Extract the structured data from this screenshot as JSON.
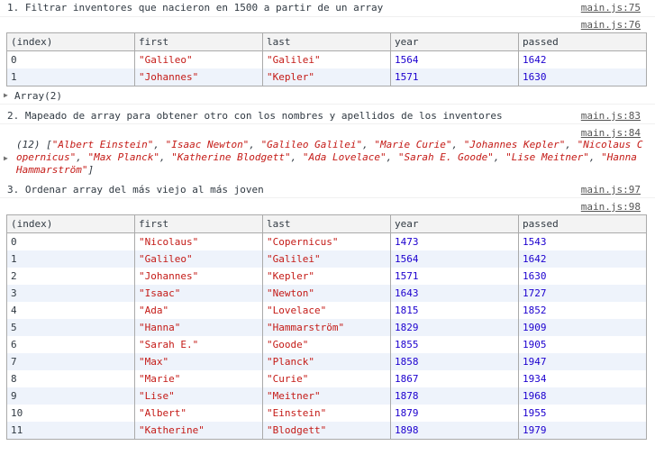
{
  "messages": [
    {
      "text": "1. Filtrar inventores que nacieron en 1500 a partir de un array",
      "source": "main.js:75"
    },
    {
      "text": "2. Mapeado de array para obtener otro con los nombres y apellidos de los inventores",
      "source": "main.js:83"
    },
    {
      "text": "3. Ordenar array del más viejo al más joven",
      "source": "main.js:97"
    }
  ],
  "table1": {
    "source": "main.js:76",
    "headers": [
      "(index)",
      "first",
      "last",
      "year",
      "passed"
    ],
    "rows": [
      [
        "0",
        "\"Galileo\"",
        "\"Galilei\"",
        "1564",
        "1642"
      ],
      [
        "1",
        "\"Johannes\"",
        "\"Kepler\"",
        "1571",
        "1630"
      ]
    ],
    "array_label": "Array(2)"
  },
  "map_log": {
    "source": "main.js:84",
    "count": "(12)",
    "items": [
      "Albert Einstein",
      "Isaac Newton",
      "Galileo Galilei",
      "Marie Curie",
      "Johannes Kepler",
      "Nicolaus Copernicus",
      "Max Planck",
      "Katherine Blodgett",
      "Ada Lovelace",
      "Sarah E. Goode",
      "Lise Meitner",
      "Hanna Hammarström"
    ]
  },
  "table2": {
    "source": "main.js:98",
    "headers": [
      "(index)",
      "first",
      "last",
      "year",
      "passed"
    ],
    "rows": [
      [
        "0",
        "\"Nicolaus\"",
        "\"Copernicus\"",
        "1473",
        "1543"
      ],
      [
        "1",
        "\"Galileo\"",
        "\"Galilei\"",
        "1564",
        "1642"
      ],
      [
        "2",
        "\"Johannes\"",
        "\"Kepler\"",
        "1571",
        "1630"
      ],
      [
        "3",
        "\"Isaac\"",
        "\"Newton\"",
        "1643",
        "1727"
      ],
      [
        "4",
        "\"Ada\"",
        "\"Lovelace\"",
        "1815",
        "1852"
      ],
      [
        "5",
        "\"Hanna\"",
        "\"Hammarström\"",
        "1829",
        "1909"
      ],
      [
        "6",
        "\"Sarah E.\"",
        "\"Goode\"",
        "1855",
        "1905"
      ],
      [
        "7",
        "\"Max\"",
        "\"Planck\"",
        "1858",
        "1947"
      ],
      [
        "8",
        "\"Marie\"",
        "\"Curie\"",
        "1867",
        "1934"
      ],
      [
        "9",
        "\"Lise\"",
        "\"Meitner\"",
        "1878",
        "1968"
      ],
      [
        "10",
        "\"Albert\"",
        "\"Einstein\"",
        "1879",
        "1955"
      ],
      [
        "11",
        "\"Katherine\"",
        "\"Blodgett\"",
        "1898",
        "1979"
      ]
    ]
  },
  "colors": {
    "string": "#c41a16",
    "number": "#1c00cf",
    "link": "#545454"
  }
}
